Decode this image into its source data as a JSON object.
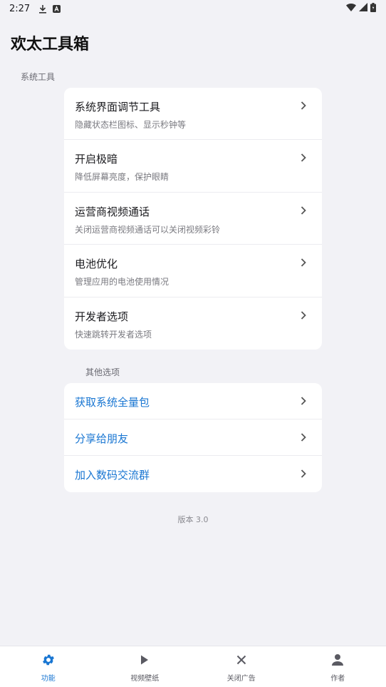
{
  "status_bar": {
    "time": "2:27",
    "icons": [
      "download-icon",
      "a-notification-icon",
      "wifi-icon",
      "signal-icon",
      "battery-icon"
    ]
  },
  "app": {
    "title": "欢太工具箱"
  },
  "sections": {
    "system": {
      "label": "系统工具",
      "items": [
        {
          "title": "系统界面调节工具",
          "desc": "隐藏状态栏图标、显示秒钟等"
        },
        {
          "title": "开启极暗",
          "desc": "降低屏幕亮度，保护眼睛"
        },
        {
          "title": "运营商视频通话",
          "desc": "关闭运营商视频通话可以关闭视频彩铃"
        },
        {
          "title": "电池优化",
          "desc": "管理应用的电池使用情况"
        },
        {
          "title": "开发者选项",
          "desc": "快速跳转开发者选项"
        }
      ]
    },
    "other": {
      "label": "其他选项",
      "items": [
        {
          "title": "获取系统全量包"
        },
        {
          "title": "分享给朋友"
        },
        {
          "title": "加入数码交流群"
        }
      ]
    }
  },
  "version": "版本 3.0",
  "bottom_nav": {
    "items": [
      {
        "label": "功能",
        "icon": "gear-icon",
        "active": true
      },
      {
        "label": "视频壁纸",
        "icon": "play-icon",
        "active": false
      },
      {
        "label": "关闭广告",
        "icon": "close-icon",
        "active": false
      },
      {
        "label": "作者",
        "icon": "person-icon",
        "active": false
      }
    ]
  },
  "colors": {
    "accent": "#1976d2",
    "background": "#f2f2f6",
    "card": "#ffffff"
  }
}
